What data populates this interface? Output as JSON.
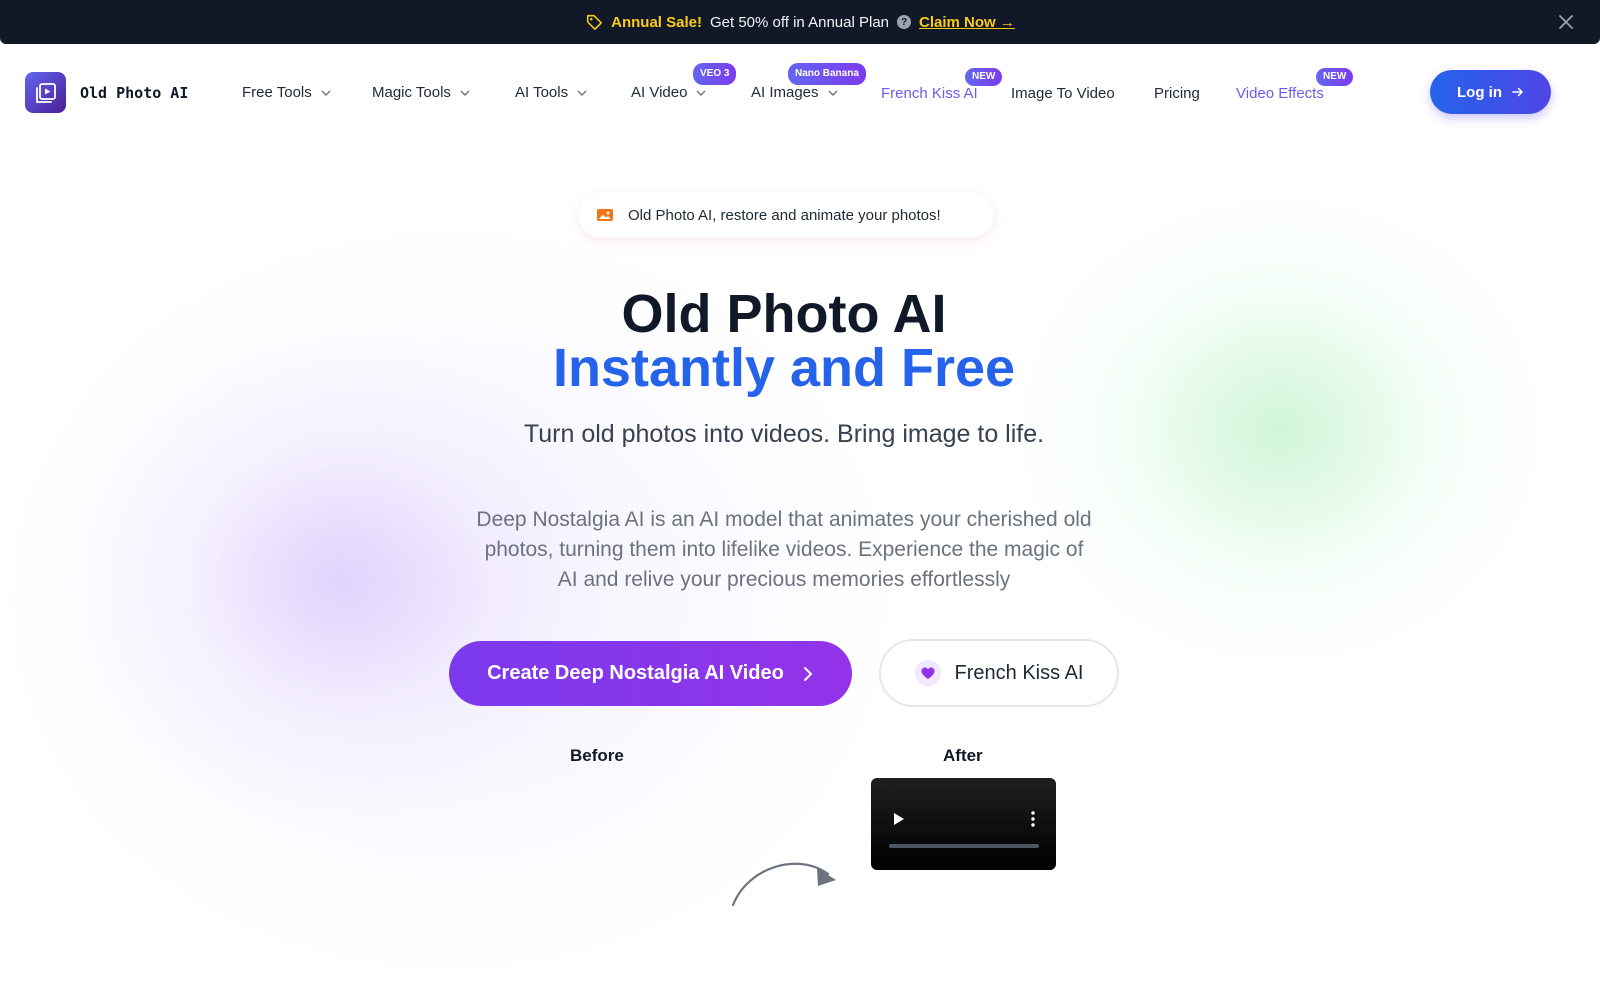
{
  "announcement": {
    "sale_label": "Annual Sale!",
    "message": "Get 50% off in Annual Plan",
    "help_glyph": "?",
    "cta": "Claim Now →",
    "icons": {
      "tag": "tag-icon",
      "close": "close-icon"
    }
  },
  "header": {
    "logo_text": "Old Photo AI",
    "nav": [
      {
        "label": "Free Tools",
        "dropdown": true
      },
      {
        "label": "Magic Tools",
        "dropdown": true
      },
      {
        "label": "AI Tools",
        "dropdown": true
      },
      {
        "label": "AI Video",
        "dropdown": true,
        "badge": "VEO 3"
      },
      {
        "label": "AI Images",
        "dropdown": true,
        "badge": "Nano Banana"
      },
      {
        "label": "French Kiss AI",
        "dropdown": false,
        "badge": "NEW"
      },
      {
        "label": "Image To Video",
        "dropdown": false
      },
      {
        "label": "Pricing",
        "dropdown": false
      },
      {
        "label": "Video Effects",
        "dropdown": false,
        "badge": "NEW"
      }
    ],
    "login_label": "Log in"
  },
  "hero": {
    "pill_text": "Old Photo AI, restore and animate your photos!",
    "title_line1": "Old Photo AI",
    "title_line2": "Instantly and Free",
    "subtitle": "Turn old photos into videos. Bring image to life.",
    "description": "Deep Nostalgia AI is an AI model that animates your cherished old photos, turning them into lifelike videos. Experience the magic of AI and relive your precious memories effortlessly",
    "primary_cta": "Create Deep Nostalgia AI Video",
    "secondary_cta": "French Kiss AI",
    "before_label": "Before",
    "after_label": "After"
  },
  "colors": {
    "brand_blue": "#2563eb",
    "brand_purple": "#7c3aed",
    "sale_yellow": "#facc15",
    "accent_nav": "#6d5bf0",
    "topbar_bg": "#111827"
  }
}
